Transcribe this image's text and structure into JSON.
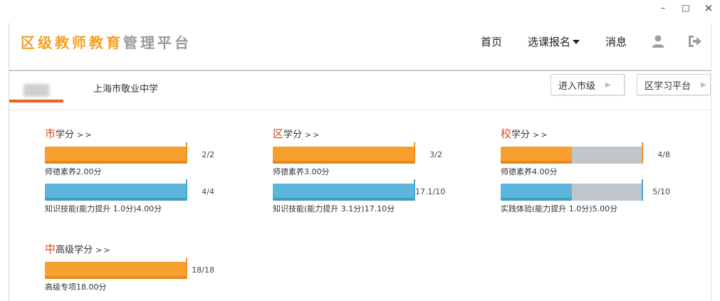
{
  "window": {
    "minimize": "–",
    "maximize": "□",
    "close": "×"
  },
  "header": {
    "logo_part1": "区级教师教育",
    "logo_part2": "管理平台",
    "nav": {
      "home": "首页",
      "courses": "选课报名",
      "messages": "消息"
    }
  },
  "subbar": {
    "school": "上海市敬业中学",
    "btn_city": "进入市级",
    "btn_district": "区学习平台"
  },
  "colors": {
    "accent": "#f5a024",
    "orange_bar": "#f7a030",
    "blue_bar": "#5cb6dc",
    "track": "#c0c6c9",
    "highlight": "#e0451a"
  },
  "credits": [
    {
      "title_hl": "市",
      "title_rest": "学分",
      "more": ">>",
      "items": [
        {
          "value": "2/2",
          "label": "师德素养2.00分",
          "fraction": 1.0,
          "color": "orange"
        },
        {
          "value": "4/4",
          "label": "知识技能(能力提升 1.0分)4.00分",
          "fraction": 1.0,
          "color": "blue"
        }
      ]
    },
    {
      "title_hl": "区",
      "title_rest": "学分",
      "more": ">>",
      "items": [
        {
          "value": "3/2",
          "label": "师德素养3.00分",
          "fraction": 1.0,
          "color": "orange"
        },
        {
          "value": "17.1/10",
          "label": "知识技能(能力提升 3.1分)17.10分",
          "fraction": 1.0,
          "color": "blue"
        }
      ]
    },
    {
      "title_hl": "校",
      "title_rest": "学分",
      "more": ">>",
      "items": [
        {
          "value": "4/8",
          "label": "师德素养4.00分",
          "fraction": 0.5,
          "color": "orange"
        },
        {
          "value": "5/10",
          "label": "实践体验(能力提升 1.0分)5.00分",
          "fraction": 0.5,
          "color": "blue"
        }
      ]
    },
    {
      "title_hl": "中",
      "title_rest": "高级学分",
      "more": ">>",
      "items": [
        {
          "value": "18/18",
          "label": "高级专项18.00分",
          "fraction": 1.0,
          "color": "orange"
        }
      ]
    }
  ]
}
